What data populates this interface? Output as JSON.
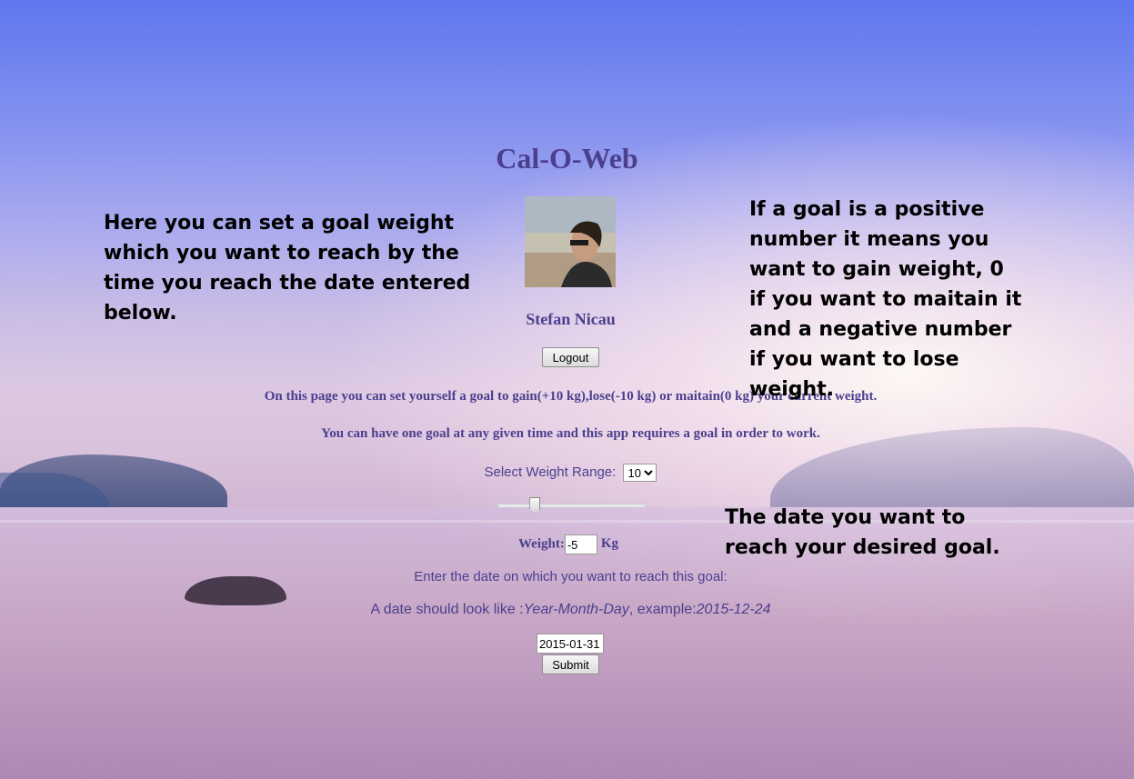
{
  "app": {
    "title": "Cal-O-Web"
  },
  "user": {
    "name": "Stefan Nicau"
  },
  "buttons": {
    "logout": "Logout",
    "submit": "Submit"
  },
  "info": {
    "line1": "On this page you can set yourself a goal to gain(+10 kg),lose(-10 kg) or maitain(0 kg) your current weight.",
    "line2": "You can have one goal at any given time and this app requires a goal in order to work."
  },
  "range": {
    "label": "Select Weight Range:",
    "selected": "10"
  },
  "slider": {
    "value": -5,
    "min": -10,
    "max": 10
  },
  "weight": {
    "label": "Weight:",
    "value": "-5",
    "unit": "Kg"
  },
  "date": {
    "label": "Enter the date on which you want to reach this goal:",
    "hint_prefix": "A date should look like :",
    "hint_format": "Year-Month-Day",
    "hint_mid": ", example:",
    "hint_example": "2015-12-24",
    "value": "2015-01-31"
  },
  "annotations": {
    "left": "Here you can set a goal weight which you want to reach by the time you reach the date entered below.",
    "right": "If a goal is a positive number it means you want to gain weight, 0 if you want to maitain it and a negative number if you want to lose weight.",
    "date": "The date you want to reach your desired goal."
  }
}
